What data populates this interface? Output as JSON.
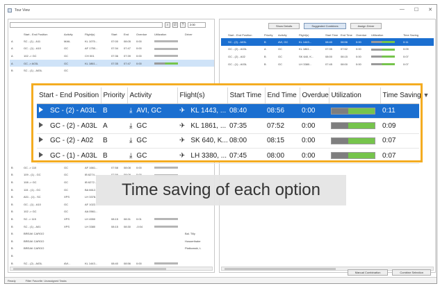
{
  "window": {
    "title": "Tour View",
    "minimize": "—",
    "maximize": "☐",
    "close": "✕"
  },
  "left_toolbar": {
    "search_value": "",
    "zoom_value": "2:00"
  },
  "right_toolbar": {
    "buttons": [
      "Show Details",
      "Suggested Combines",
      "Assign Driver"
    ]
  },
  "left_table": {
    "headers": [
      "",
      "Start - End Position",
      "Activity",
      "Flight(s)",
      "Start",
      "End",
      "Overdue",
      "Utilization",
      "Driver"
    ],
    "rows": [
      [
        "A",
        "SC - (1) - A11",
        "MAIL",
        "KL 1075...",
        "07:00",
        "08:05",
        "0:00",
        "",
        ""
      ],
      [
        "A",
        "GC - (1) - A10",
        "GC",
        "AF 1750...",
        "07:34",
        "07:47",
        "0:00",
        "",
        ""
      ],
      [
        "A",
        "102 -> GC",
        "GC",
        "CH 001",
        "07:36",
        "07:39",
        "0:00",
        "",
        ""
      ],
      [
        "A",
        "GC -> A03L",
        "GC",
        "KL 1861...",
        "07:35",
        "07:47",
        "0:00",
        "",
        ""
      ],
      [
        "B",
        "SC - (1) - A03L",
        "GC",
        "",
        "",
        "",
        "",
        "",
        ""
      ]
    ],
    "rows_lower": [
      [
        "B",
        "GC -> 110",
        "GC",
        "AF 1661...",
        "07:58",
        "08:08",
        "0:00",
        "",
        ""
      ],
      [
        "B",
        "109 - (1) - GC",
        "GC",
        "IB 6274...",
        "07:56",
        "08:09",
        "0:00",
        "",
        ""
      ],
      [
        "B",
        "108 -> GC",
        "GC",
        "IB 6272...",
        "",
        "",
        "",
        "",
        ""
      ],
      [
        "B",
        "115 - (1) - GC",
        "GC",
        "BA 6612...",
        "",
        "",
        "",
        "",
        ""
      ],
      [
        "B",
        "A01 - (1) - SC",
        "XPS",
        "LH 3378...",
        "",
        "",
        "",
        "",
        ""
      ],
      [
        "B",
        "GC - (1) - A10",
        "GC",
        "AF 1022...",
        "",
        "",
        "",
        "",
        ""
      ],
      [
        "B",
        "102 -> GC",
        "GC",
        "AA 0561...",
        "",
        "",
        "",
        "",
        ""
      ],
      [
        "B",
        "SC -> 115",
        "XPS",
        "LH 4550",
        "08:15",
        "08:31",
        "0:01",
        "",
        ""
      ],
      [
        "B",
        "SC - (1) - A01",
        "XPS",
        "LH 3380",
        "08:15",
        "08:30",
        "-0:04",
        "",
        ""
      ],
      [
        "B",
        "BREAK CARGO",
        "",
        "",
        "",
        "",
        "",
        "",
        "Bal. Tilly"
      ],
      [
        "B",
        "BREAK CARGO",
        "",
        "",
        "",
        "",
        "",
        "",
        "Hosserthaler"
      ],
      [
        "B",
        "BREAK CARGO",
        "",
        "",
        "",
        "",
        "",
        "",
        "Piatkowski, L"
      ],
      [
        "B",
        "",
        "",
        "",
        "",
        "",
        "",
        "",
        ""
      ],
      [
        "B",
        "SC - (2) - A03L",
        "AVI...",
        "KL 1443...",
        "08:40",
        "08:56",
        "0:00",
        "",
        ""
      ]
    ]
  },
  "right_table": {
    "headers": [
      "",
      "Start - End Position",
      "Priority",
      "Activity",
      "Flight(s)",
      "Start Time",
      "End Time",
      "Overdue",
      "Utilization",
      "Time Saving"
    ],
    "rows": [
      [
        "",
        "SC - (2) - A03L",
        "B",
        "AVI, GC",
        "KL 1443...",
        "08:40",
        "08:56",
        "0:00",
        "",
        "0:11"
      ],
      [
        "",
        "GC - (2) - A03L",
        "A",
        "GC",
        "KL 1861...",
        "07:35",
        "07:52",
        "0:00",
        "",
        "0:09"
      ],
      [
        "",
        "GC - (2) - A02",
        "B",
        "GC",
        "SK 640, K...",
        "08:00",
        "08:15",
        "0:00",
        "",
        "0:07"
      ],
      [
        "",
        "GC - (1) - A03L",
        "B",
        "GC",
        "LH 3380...",
        "07:45",
        "08:00",
        "0:00",
        "",
        "0:07"
      ]
    ]
  },
  "bottom_buttons": [
    "Manual Combination",
    "Combine Selection"
  ],
  "status_bar": {
    "left": "Ready",
    "right": "Filter Favorite: Unassigned Tasks"
  },
  "zoom": {
    "headers": {
      "position": "Start - End Position",
      "priority": "Priority",
      "activity": "Activity",
      "flights": "Flight(s)",
      "start": "Start Time",
      "end": "End Time",
      "overdue": "Overdue",
      "utilization": "Utilization",
      "saving": "Time Saving"
    },
    "rows": [
      {
        "position": "SC - (2) - A03L",
        "priority": "B",
        "activity": "AVI, GC",
        "flights": "KL 1443, ...",
        "start": "08:40",
        "end": "08:56",
        "overdue": "0:00",
        "saving": "0:11",
        "utilization": 0.63
      },
      {
        "position": "GC - (2) - A03L",
        "priority": "A",
        "activity": "GC",
        "flights": "KL 1861, ...",
        "start": "07:35",
        "end": "07:52",
        "overdue": "0:00",
        "saving": "0:09",
        "utilization": 0.63
      },
      {
        "position": "GC - (2) - A02",
        "priority": "B",
        "activity": "GC",
        "flights": "SK 640, K...",
        "start": "08:00",
        "end": "08:15",
        "overdue": "0:00",
        "saving": "0:07",
        "utilization": 0.63
      },
      {
        "position": "GC - (1) - A03L",
        "priority": "B",
        "activity": "GC",
        "flights": "LH 3380, ...",
        "start": "07:45",
        "end": "08:00",
        "overdue": "0:00",
        "saving": "0:07",
        "utilization": 0.63
      }
    ]
  },
  "caption": "Time saving of each option",
  "colors": {
    "highlight": "#f4ac21",
    "selection": "#1b6fd0",
    "util_green": "#76c44c"
  }
}
